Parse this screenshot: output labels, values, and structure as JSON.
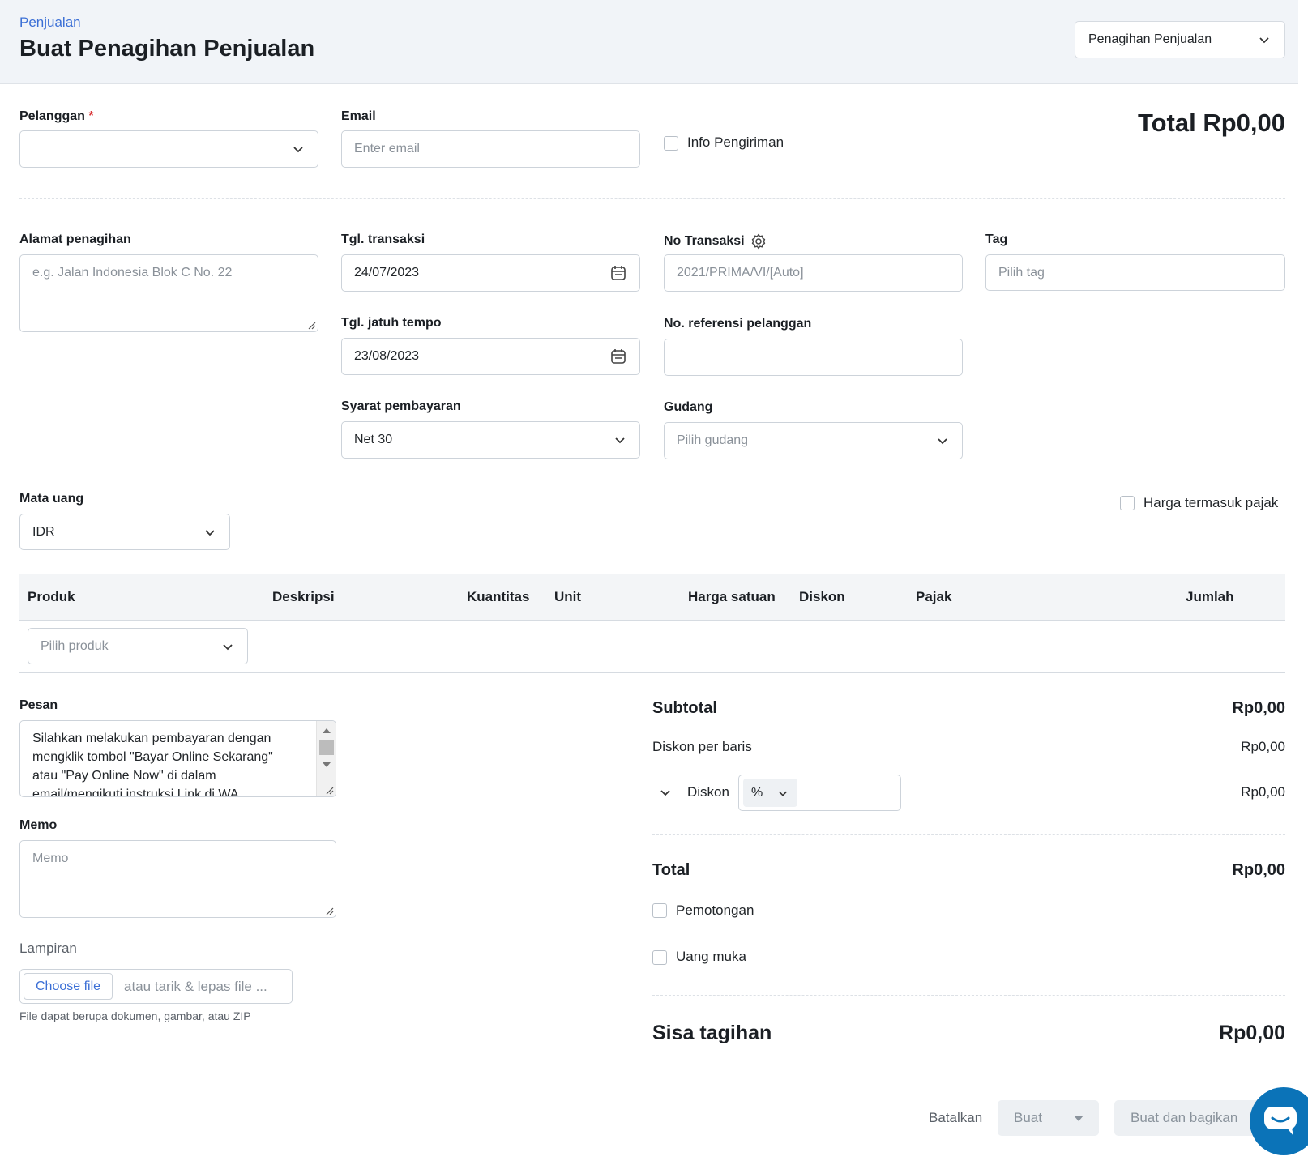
{
  "header": {
    "breadcrumb": "Penjualan",
    "title": "Buat Penagihan Penjualan",
    "type_select": "Penagihan Penjualan"
  },
  "form": {
    "customer_label": "Pelanggan",
    "required_mark": "*",
    "email_label": "Email",
    "email_placeholder": "Enter email",
    "shipping_info_label": "Info Pengiriman",
    "total_heading": "Total Rp0,00",
    "billing_address_label": "Alamat penagihan",
    "billing_address_placeholder": "e.g. Jalan Indonesia Blok C No. 22",
    "transaction_date_label": "Tgl. transaksi",
    "transaction_date_value": "24/07/2023",
    "transaction_no_label": "No Transaksi",
    "transaction_no_placeholder": "2021/PRIMA/VI/[Auto]",
    "tag_label": "Tag",
    "tag_placeholder": "Pilih tag",
    "due_date_label": "Tgl. jatuh tempo",
    "due_date_value": "23/08/2023",
    "customer_ref_label": "No. referensi pelanggan",
    "payment_terms_label": "Syarat pembayaran",
    "payment_terms_value": "Net 30",
    "warehouse_label": "Gudang",
    "warehouse_placeholder": "Pilih gudang",
    "currency_label": "Mata uang",
    "currency_value": "IDR",
    "price_incl_tax_label": "Harga termasuk pajak"
  },
  "table": {
    "headers": [
      "Produk",
      "Deskripsi",
      "Kuantitas",
      "Unit",
      "Harga satuan",
      "Diskon",
      "Pajak",
      "Jumlah"
    ],
    "product_placeholder": "Pilih produk"
  },
  "message": {
    "label": "Pesan",
    "text": "Silahkan melakukan pembayaran dengan mengklik tombol \"Bayar Online Sekarang\" atau \"Pay Online Now\" di dalam email/mengikuti instruksi Link di WA"
  },
  "memo": {
    "label": "Memo",
    "placeholder": "Memo"
  },
  "attachment": {
    "label": "Lampiran",
    "choose_file": "Choose file",
    "drop_hint": "atau tarik & lepas file ...",
    "help": "File dapat berupa dokumen, gambar, atau ZIP"
  },
  "summary": {
    "subtotal_label": "Subtotal",
    "subtotal_value": "Rp0,00",
    "line_discount_label": "Diskon per baris",
    "line_discount_value": "Rp0,00",
    "discount_label": "Diskon",
    "discount_unit": "%",
    "discount_value": "Rp0,00",
    "total_label": "Total",
    "total_value": "Rp0,00",
    "deduction_label": "Pemotongan",
    "down_payment_label": "Uang muka",
    "remaining_label": "Sisa tagihan",
    "remaining_value": "Rp0,00"
  },
  "actions": {
    "cancel": "Batalkan",
    "create": "Buat",
    "create_share": "Buat dan bagikan"
  },
  "colors": {
    "link": "#3b6fd6",
    "header_bg": "#f1f4f8",
    "chat_button": "#0b73b8",
    "required": "#d9383a"
  }
}
